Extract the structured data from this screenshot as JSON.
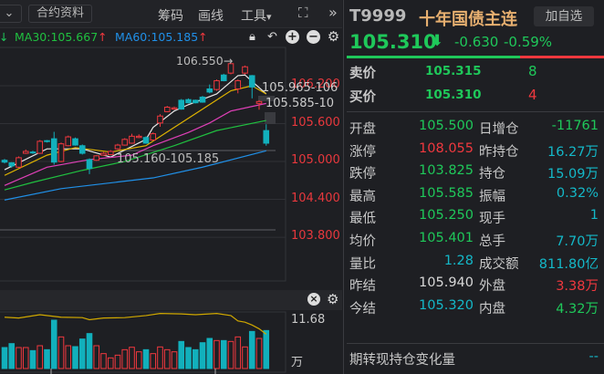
{
  "toolbar": {
    "dropdown_icon": "chevron-down-icon",
    "contract_info": "合约资料",
    "chips": "筹码",
    "draw": "画线",
    "tools": "工具",
    "tools_arrow": "▾",
    "fullscreen_icon": "expand-icon",
    "more": "»"
  },
  "ma_row": {
    "prefix_arrow": "↓",
    "ma30": "MA30:105.667",
    "ma30_arrow": "↑",
    "ma60": "MA60:105.185",
    "ma60_arrow": "↑",
    "icons": [
      "lock-icon",
      "undo-icon",
      "zoom-in-icon",
      "zoom-out-icon",
      "gear-icon"
    ]
  },
  "colors": {
    "up": "#f0383e",
    "down": "#12b0bc",
    "ma5": "#e8e8e8",
    "ma10": "#e0b400",
    "ma20": "#e040b8",
    "ma30": "#20c040",
    "ma60": "#2090e8",
    "volma": "#d0a800"
  },
  "chart_data": {
    "type": "candlestick",
    "price_ticks": [
      "106.200",
      "105.600",
      "105.000",
      "104.400",
      "103.800"
    ],
    "price_tick_values": [
      106.2,
      105.6,
      105.0,
      104.4,
      103.8
    ],
    "annotations": {
      "high": "106.550→",
      "label_a": "105.965-106",
      "label_b": "105.585-10",
      "label_c": "105.160-105.185"
    },
    "candles": [
      [
        105.02,
        104.99,
        105.04,
        104.97
      ],
      [
        104.98,
        104.93,
        104.99,
        104.9
      ],
      [
        104.91,
        105.06,
        105.08,
        104.9
      ],
      [
        105.13,
        105.16,
        105.19,
        105.12
      ],
      [
        105.15,
        105.14,
        105.17,
        105.12
      ],
      [
        105.13,
        105.32,
        105.34,
        105.12
      ],
      [
        105.33,
        105.32,
        105.34,
        105.3
      ],
      [
        105.36,
        104.99,
        105.47,
        104.95
      ],
      [
        105.0,
        105.28,
        105.3,
        104.99
      ],
      [
        105.25,
        105.39,
        105.41,
        105.24
      ],
      [
        105.36,
        105.26,
        105.38,
        105.25
      ],
      [
        105.25,
        105.13,
        105.27,
        105.11
      ],
      [
        105.03,
        104.89,
        105.05,
        104.8
      ],
      [
        105.02,
        105.09,
        105.1,
        105.01
      ],
      [
        105.1,
        105.13,
        105.15,
        105.09
      ],
      [
        105.11,
        105.16,
        105.18,
        105.1
      ],
      [
        105.2,
        105.26,
        105.28,
        105.19
      ],
      [
        105.26,
        105.35,
        105.37,
        105.25
      ],
      [
        105.29,
        105.4,
        105.44,
        105.28
      ],
      [
        105.38,
        105.4,
        105.43,
        105.37
      ],
      [
        105.38,
        105.29,
        105.4,
        105.28
      ],
      [
        105.34,
        105.44,
        105.46,
        105.33
      ],
      [
        105.61,
        105.72,
        105.75,
        105.55
      ],
      [
        105.79,
        105.86,
        105.88,
        105.78
      ],
      [
        105.83,
        105.85,
        105.87,
        105.82
      ],
      [
        105.97,
        105.83,
        105.99,
        105.82
      ],
      [
        105.98,
        105.93,
        106.0,
        105.92
      ],
      [
        105.97,
        105.93,
        105.98,
        105.92
      ],
      [
        106.02,
        105.94,
        106.04,
        105.93
      ],
      [
        106.15,
        106.1,
        106.22,
        106.08
      ],
      [
        106.14,
        106.28,
        106.3,
        106.12
      ],
      [
        106.37,
        106.28,
        106.39,
        106.27
      ],
      [
        106.4,
        106.55,
        106.55,
        106.38
      ],
      [
        106.15,
        106.28,
        106.3,
        106.08
      ],
      [
        106.4,
        106.5,
        106.52,
        106.38
      ],
      [
        106.36,
        106.18,
        106.37,
        106.0
      ],
      [
        105.92,
        105.95,
        105.97,
        105.82
      ],
      [
        105.49,
        105.29,
        105.59,
        105.25
      ]
    ],
    "ma_lines": [
      {
        "name": "MA5",
        "points": [
          [
            0,
            104.87
          ],
          [
            6,
            105.2
          ],
          [
            11,
            105.2
          ],
          [
            15,
            105.07
          ],
          [
            20,
            105.35
          ],
          [
            21,
            105.54
          ],
          [
            24,
            105.8
          ],
          [
            26,
            105.9
          ],
          [
            30,
            106.07
          ],
          [
            33,
            106.36
          ],
          [
            34,
            106.37
          ],
          [
            37,
            106.07
          ]
        ]
      },
      {
        "name": "MA10",
        "points": [
          [
            0,
            104.78
          ],
          [
            6,
            105.1
          ],
          [
            10,
            105.22
          ],
          [
            15,
            105.15
          ],
          [
            20,
            105.25
          ],
          [
            24,
            105.54
          ],
          [
            28,
            105.83
          ],
          [
            32,
            106.12
          ],
          [
            35,
            106.2
          ],
          [
            37,
            106.07
          ]
        ]
      },
      {
        "name": "MA20",
        "points": [
          [
            0,
            104.62
          ],
          [
            6,
            104.91
          ],
          [
            12,
            105.03
          ],
          [
            18,
            105.1
          ],
          [
            21,
            105.25
          ],
          [
            26,
            105.46
          ],
          [
            29,
            105.61
          ],
          [
            32,
            105.8
          ],
          [
            37,
            105.92
          ]
        ]
      },
      {
        "name": "MA30",
        "points": [
          [
            0,
            104.55
          ],
          [
            4,
            104.67
          ],
          [
            11,
            104.86
          ],
          [
            17,
            105.0
          ],
          [
            24,
            105.25
          ],
          [
            30,
            105.49
          ],
          [
            37,
            105.65
          ]
        ]
      },
      {
        "name": "MA60",
        "points": [
          [
            0,
            104.39
          ],
          [
            8,
            104.57
          ],
          [
            21,
            104.74
          ],
          [
            28,
            104.91
          ],
          [
            37,
            105.17
          ]
        ]
      }
    ],
    "volume": {
      "max_label": "11.68",
      "unit": "万",
      "max": 11.68,
      "values": [
        5.07,
        6.02,
        5.07,
        5.07,
        4.33,
        5.51,
        4.55,
        11.68,
        7.64,
        5.51,
        5.29,
        7.13,
        8.45,
        5.51,
        3.6,
        2.57,
        3.23,
        4.55,
        5.14,
        4.04,
        4.55,
        3.6,
        5.22,
        4.55,
        4.04,
        6.54,
        5.07,
        4.55,
        6.24,
        7.27,
        6.76,
        6.76,
        6.54,
        7.64,
        5.22,
        8.96,
        7.27,
        9.18
      ],
      "ma_points": [
        [
          0,
          12.4
        ],
        [
          2,
          12.2
        ],
        [
          5,
          13.0
        ],
        [
          8,
          12.4
        ],
        [
          11,
          12.3
        ],
        [
          12,
          11.8
        ],
        [
          14,
          12.2
        ],
        [
          17,
          12.3
        ],
        [
          20,
          12.8
        ],
        [
          22,
          13.3
        ],
        [
          25,
          13.2
        ],
        [
          27,
          13.0
        ],
        [
          30,
          13.3
        ],
        [
          32,
          12.8
        ],
        [
          33,
          11.5
        ],
        [
          34,
          11.2
        ],
        [
          35,
          10.5
        ],
        [
          36,
          9.6
        ],
        [
          37,
          8.3
        ]
      ]
    }
  },
  "vol_header": {
    "icons": [
      "close-circle-icon",
      "gear-icon"
    ]
  },
  "quote": {
    "code": "T9999",
    "name": "十年国债主连",
    "watch_btn": "加自选",
    "price": "105.310",
    "arrow": "⬇",
    "change": "-0.630",
    "change_pct": "-0.59%",
    "buy_ratio": 0.67,
    "ask_label": "卖价",
    "ask_price": "105.315",
    "ask_vol": "8",
    "bid_label": "买价",
    "bid_price": "105.310",
    "bid_vol": "4",
    "rows": [
      {
        "l1": "开盘",
        "v1": "105.500",
        "c1": "g",
        "l2": "日增仓",
        "v2": "-11761",
        "c2": "g"
      },
      {
        "l1": "涨停",
        "v1": "108.055",
        "c1": "r",
        "l2": "昨持仓",
        "v2": "16.27万",
        "c2": "c"
      },
      {
        "l1": "跌停",
        "v1": "103.825",
        "c1": "g",
        "l2": "持仓",
        "v2": "15.09万",
        "c2": "c"
      },
      {
        "l1": "最高",
        "v1": "105.585",
        "c1": "g",
        "l2": "振幅",
        "v2": "0.32%",
        "c2": "c"
      },
      {
        "l1": "最低",
        "v1": "105.250",
        "c1": "g",
        "l2": "现手",
        "v2": "1",
        "c2": "c"
      },
      {
        "l1": "均价",
        "v1": "105.401",
        "c1": "g",
        "l2": "总手",
        "v2": "7.70万",
        "c2": "c"
      },
      {
        "l1": "量比",
        "v1": "1.28",
        "c1": "c",
        "l2": "成交额",
        "v2": "811.80亿",
        "c2": "c"
      },
      {
        "l1": "昨结",
        "v1": "105.940",
        "c1": "w",
        "l2": "外盘",
        "v2": "3.38万",
        "c2": "r"
      },
      {
        "l1": "今结",
        "v1": "105.320",
        "c1": "c",
        "l2": "内盘",
        "v2": "4.32万",
        "c2": "g"
      }
    ],
    "efp_label": "期转现持仓变化量",
    "efp_value": "--"
  }
}
